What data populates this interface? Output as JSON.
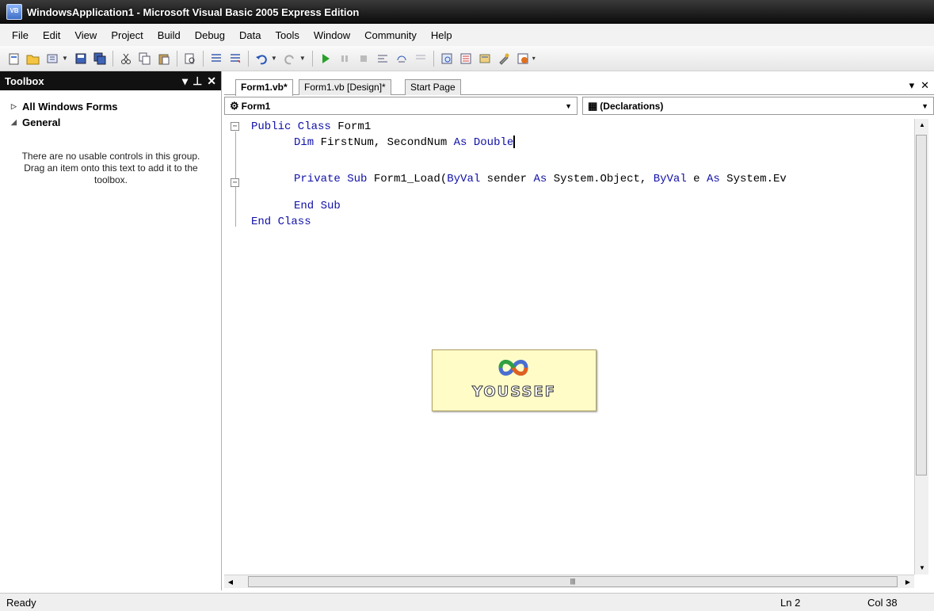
{
  "window": {
    "title": "WindowsApplication1 - Microsoft Visual Basic 2005 Express Edition",
    "app_icon_text": "VB"
  },
  "menu": [
    "File",
    "Edit",
    "View",
    "Project",
    "Build",
    "Debug",
    "Data",
    "Tools",
    "Window",
    "Community",
    "Help"
  ],
  "toolbox": {
    "title": "Toolbox",
    "group_all": "All Windows Forms",
    "group_general": "General",
    "empty_message": "There are no usable controls in this group. Drag an item onto this text to add it to the toolbox."
  },
  "tabs": [
    {
      "label": "Form1.vb*",
      "active": true
    },
    {
      "label": "Form1.vb [Design]*",
      "active": false
    },
    {
      "label": "Start Page",
      "active": false
    }
  ],
  "combos": {
    "class_name": "Form1",
    "method_name": "(Declarations)"
  },
  "code": {
    "line1_kw": "Public Class",
    "line1_rest": " Form1",
    "line2_kw1": "Dim",
    "line2_mid": " FirstNum, SecondNum ",
    "line2_kw2": "As Double",
    "line3_kw": "Private Sub",
    "line3_a": " Form1_Load(",
    "line3_kw2": "ByVal",
    "line3_b": " sender ",
    "line3_kw3": "As",
    "line3_c": " System.Object, ",
    "line3_kw4": "ByVal",
    "line3_d": " e ",
    "line3_kw5": "As",
    "line3_e": " System.Ev",
    "line4_kw": "End Sub",
    "line5_kw": "End Class"
  },
  "logo": {
    "text": "YOUSSEF"
  },
  "status": {
    "text": "Ready",
    "line": "Ln 2",
    "column": "Col 38"
  },
  "colors": {
    "keyword": "#1010a8",
    "titlebar": "#111111",
    "logo_bg": "#fffcc8"
  }
}
